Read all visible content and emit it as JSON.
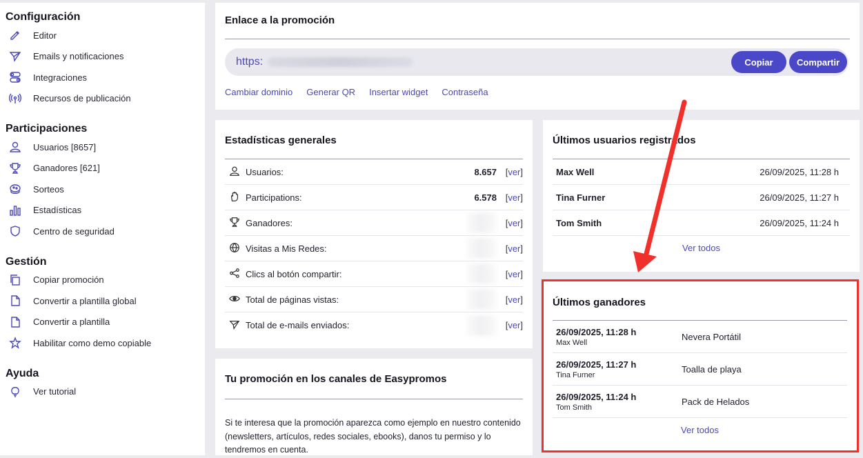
{
  "sidebar": {
    "sections": [
      {
        "title": "Configuración",
        "items": [
          {
            "label": "Editor",
            "icon": "pencil-icon"
          },
          {
            "label": "Emails y notificaciones",
            "icon": "paper-plane-icon"
          },
          {
            "label": "Integraciones",
            "icon": "toggles-icon"
          },
          {
            "label": "Recursos de publicación",
            "icon": "broadcast-icon"
          }
        ]
      },
      {
        "title": "Participaciones",
        "items": [
          {
            "label": "Usuarios [8657]",
            "icon": "user-icon"
          },
          {
            "label": "Ganadores [621]",
            "icon": "trophy-icon"
          },
          {
            "label": "Sorteos",
            "icon": "lottery-drum-icon"
          },
          {
            "label": "Estadísticas",
            "icon": "bar-chart-icon"
          },
          {
            "label": "Centro de seguridad",
            "icon": "shield-icon"
          }
        ]
      },
      {
        "title": "Gestión",
        "items": [
          {
            "label": "Copiar promoción",
            "icon": "copy-icon"
          },
          {
            "label": "Convertir a plantilla global",
            "icon": "file-icon"
          },
          {
            "label": "Convertir a plantilla",
            "icon": "file-icon"
          },
          {
            "label": "Habilitar como demo copiable",
            "icon": "star-icon"
          }
        ]
      },
      {
        "title": "Ayuda",
        "items": [
          {
            "label": "Ver tutorial",
            "icon": "lightbulb-icon"
          }
        ]
      }
    ]
  },
  "link_card": {
    "title": "Enlace a la promoción",
    "url_prefix": "https:",
    "copy_label": "Copiar",
    "share_label": "Compartir",
    "links": [
      "Cambiar dominio",
      "Generar QR",
      "Insertar widget",
      "Contraseña"
    ]
  },
  "stats_card": {
    "title": "Estadísticas generales",
    "ver_label": "ver",
    "rows": [
      {
        "label": "Usuarios:",
        "value": "8.657",
        "icon": "user-icon"
      },
      {
        "label": "Participations:",
        "value": "6.578",
        "icon": "hand-icon"
      },
      {
        "label": "Ganadores:",
        "value": "",
        "icon": "trophy-icon"
      },
      {
        "label": "Visitas a Mis Redes:",
        "value": "",
        "icon": "globe-icon"
      },
      {
        "label": "Clics al botón compartir:",
        "value": "",
        "icon": "share-icon"
      },
      {
        "label": "Total de páginas vistas:",
        "value": "",
        "icon": "eye-icon"
      },
      {
        "label": "Total de e-mails enviados:",
        "value": "",
        "icon": "paper-plane-icon"
      }
    ]
  },
  "users_card": {
    "title": "Últimos usuarios registrados",
    "rows": [
      {
        "name": "Max Well",
        "date": "26/09/2025, 11:28 h"
      },
      {
        "name": "Tina Furner",
        "date": "26/09/2025, 11:27 h"
      },
      {
        "name": "Tom Smith",
        "date": "26/09/2025, 11:24 h"
      }
    ],
    "see_all": "Ver todos"
  },
  "winners_card": {
    "title": "Últimos ganadores",
    "rows": [
      {
        "date": "26/09/2025, 11:28 h",
        "name": "Max Well",
        "prize": "Nevera Portátil"
      },
      {
        "date": "26/09/2025, 11:27 h",
        "name": "Tina Furner",
        "prize": "Toalla de playa"
      },
      {
        "date": "26/09/2025, 11:24 h",
        "name": "Tom Smith",
        "prize": "Pack de Helados"
      }
    ],
    "see_all": "Ver todos"
  },
  "promo_card": {
    "title": "Tu promoción en los canales de Easypromos",
    "text": "Si te interesa que la promoción aparezca como ejemplo en nuestro contenido (newsletters, artículos, redes sociales, ebooks), danos tu permiso y lo tendremos en cuenta."
  },
  "colors": {
    "accent": "#4a48c9",
    "annotation": "#f0302a"
  }
}
